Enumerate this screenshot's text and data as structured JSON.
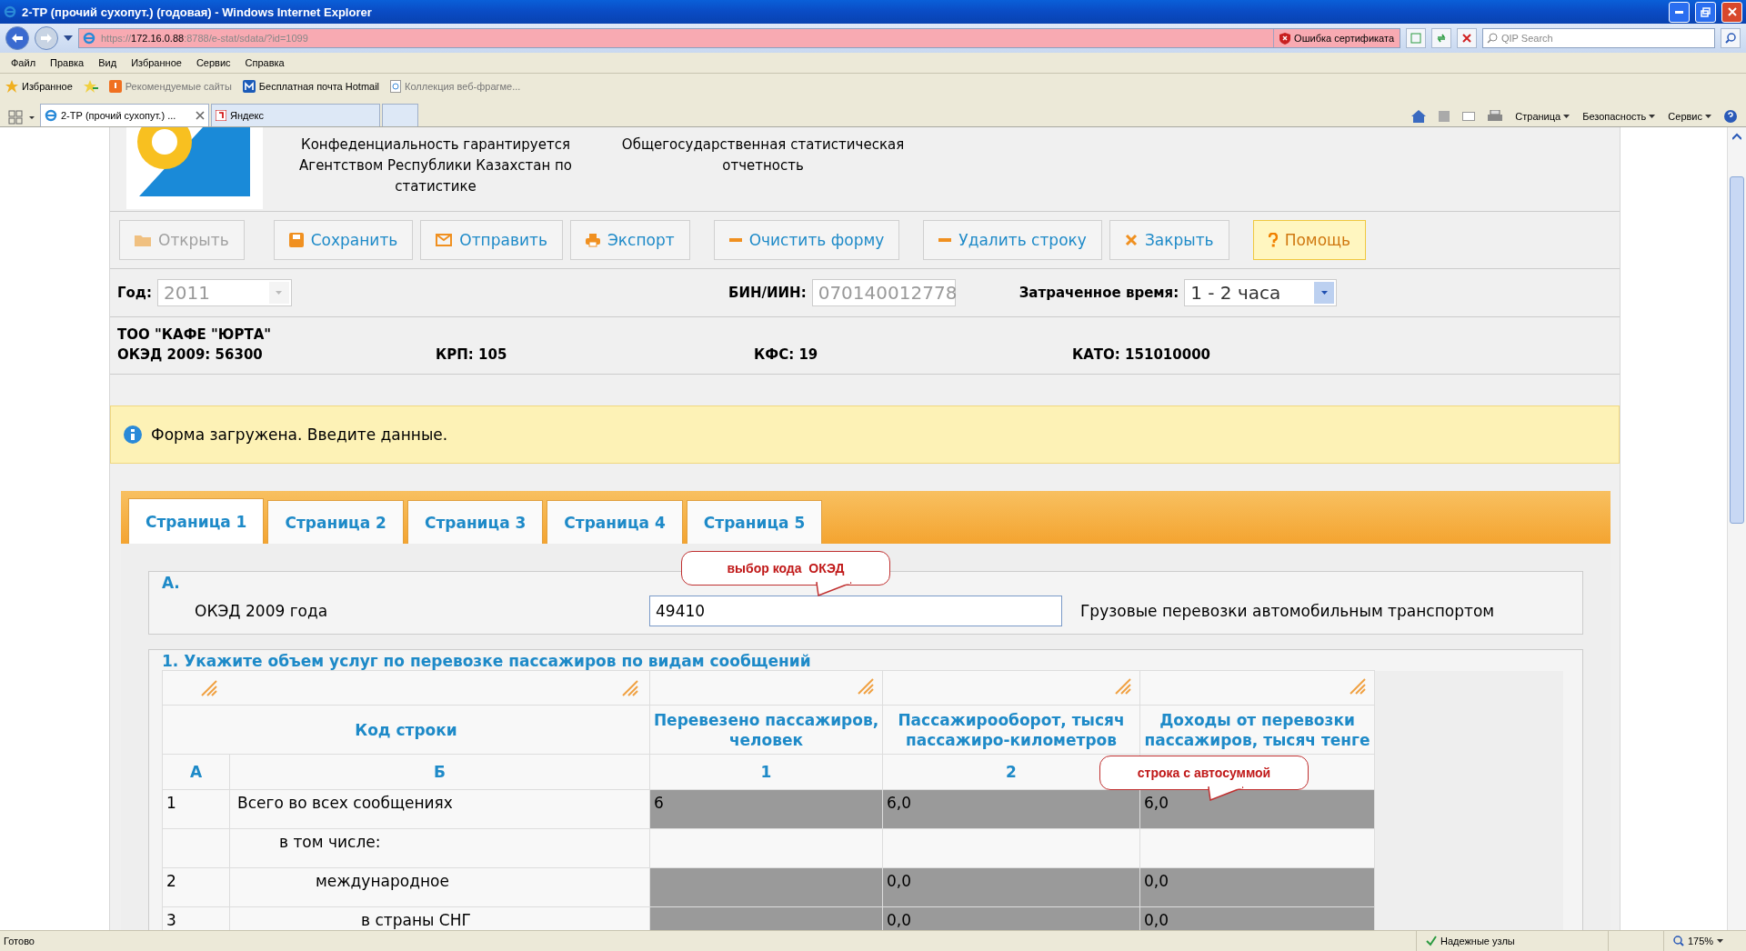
{
  "window": {
    "title": "2-ТР (прочий сухопут.) (годовая) - Windows Internet Explorer"
  },
  "address_bar": {
    "url_scheme": "https://",
    "url_host": "172.16.0.88",
    "url_rest": ":8788/e-stat/sdata/?id=1099",
    "cert_error": "Ошибка сертификата"
  },
  "search": {
    "placeholder": "QIP Search"
  },
  "menu": [
    "Файл",
    "Правка",
    "Вид",
    "Избранное",
    "Сервис",
    "Справка"
  ],
  "favorites": {
    "label": "Избранное",
    "items": [
      {
        "label": "Рекомендуемые сайты",
        "kind": "suggested"
      },
      {
        "label": "Бесплатная почта Hotmail",
        "kind": "mail"
      },
      {
        "label": "Коллекция веб-фрагме...",
        "kind": "gallery"
      }
    ]
  },
  "browser_tabs": [
    {
      "label": "2-ТР (прочий сухопут.) ...",
      "selected": true
    },
    {
      "label": "Яндекс",
      "selected": false
    }
  ],
  "command_bar": [
    "Страница",
    "Безопасность",
    "Сервис"
  ],
  "header": {
    "confidentiality": "Конфеденциальность гарантируется Агентством Республики Казахстан по статистике",
    "reporting": "Общегосударственная статистическая отчетность"
  },
  "toolbar": [
    {
      "label": "Открыть",
      "kind": "open",
      "disabled": true
    },
    {
      "label": "Сохранить",
      "kind": "save",
      "disabled": false
    },
    {
      "label": "Отправить",
      "kind": "send",
      "disabled": false
    },
    {
      "label": "Экспорт",
      "kind": "export",
      "disabled": false
    },
    {
      "label": "Очистить форму",
      "kind": "minus",
      "disabled": false
    },
    {
      "label": "Удалить строку",
      "kind": "minus",
      "disabled": false
    },
    {
      "label": "Закрыть",
      "kind": "close",
      "disabled": false
    },
    {
      "label": "Помощь",
      "kind": "help",
      "disabled": false
    }
  ],
  "fields": {
    "year": {
      "label": "Год:",
      "value": "2011"
    },
    "bin": {
      "label": "БИН/ИИН:",
      "value": "070140012778"
    },
    "time": {
      "label": "Затраченное время:",
      "value": "1 - 2 часа"
    }
  },
  "company": {
    "name": "ТОО \"КАФЕ \"ЮРТА\"",
    "codes": [
      {
        "label": "ОКЭД 2009:",
        "value": "56300"
      },
      {
        "label": "КРП:",
        "value": "105"
      },
      {
        "label": "КФС:",
        "value": "19"
      },
      {
        "label": "КАТО:",
        "value": "151010000"
      }
    ]
  },
  "notice": "Форма загружена. Введите данные.",
  "form_tabs": [
    {
      "label": "Страница 1",
      "selected": true
    },
    {
      "label": "Страница 2",
      "selected": false
    },
    {
      "label": "Страница 3",
      "selected": false
    },
    {
      "label": "Страница 4",
      "selected": false
    },
    {
      "label": "Страница 5",
      "selected": false
    }
  ],
  "section_a": {
    "title": "А.",
    "label": "ОКЭД 2009 года",
    "value": "49410",
    "description": "Грузовые перевозки автомобильным транспортом",
    "callout": "выбор кода  ОКЭД"
  },
  "section_1": {
    "title": "1. Укажите объем услуг по перевозке пассажиров по видам сообщений",
    "code_header": "Код строки",
    "columns": [
      "Перевезено пассажиров, человек",
      "Пассажирооборот, тысяч пассажиро-километров",
      "Доходы от перевозки пассажиров, тысяч тенге"
    ],
    "codes": [
      "А",
      "Б",
      "1",
      "2"
    ],
    "callout": "строка с автосуммой",
    "rows": [
      {
        "code": "1",
        "name": "Всего во всех сообщениях",
        "kind": "total",
        "cells": [
          {
            "value": "6",
            "locked": true
          },
          {
            "value": "6,0",
            "locked": true
          },
          {
            "value": "6,0",
            "locked": true
          }
        ]
      },
      {
        "name": "в том числе:",
        "kind": "heading",
        "cells": [
          {
            "locked": false
          },
          {
            "locked": false
          },
          {
            "locked": false
          }
        ]
      },
      {
        "code": "2",
        "name": "международное",
        "kind": "item",
        "cells": [
          {
            "locked": true
          },
          {
            "value": "0,0",
            "locked": true
          },
          {
            "value": "0,0",
            "locked": true
          }
        ]
      },
      {
        "code": "3",
        "name": "в страны СНГ",
        "kind": "subitem",
        "cells": [
          {
            "locked": true
          },
          {
            "value": "0,0",
            "locked": true
          },
          {
            "value": "0,0",
            "locked": true
          }
        ]
      }
    ]
  },
  "status_bar": {
    "status": "Готово",
    "zone": "Надежные узлы",
    "zoom": "175%"
  }
}
